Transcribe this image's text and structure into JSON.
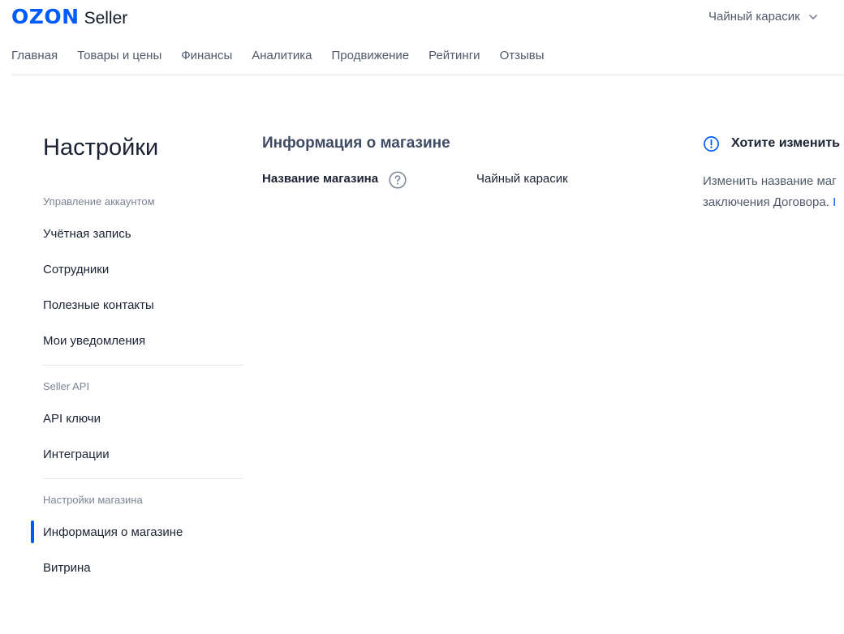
{
  "header": {
    "logo_brand": "OZON",
    "logo_product": "Seller",
    "account_name": "Чайный карасик",
    "account_chevron_icon": "chevron-down-icon",
    "nav": [
      {
        "label": "Главная"
      },
      {
        "label": "Товары и цены"
      },
      {
        "label": "Финансы"
      },
      {
        "label": "Аналитика"
      },
      {
        "label": "Продвижение"
      },
      {
        "label": "Рейтинги"
      },
      {
        "label": "Отзывы"
      }
    ]
  },
  "sidebar": {
    "title": "Настройки",
    "sections": [
      {
        "title": "Управление аккаунтом",
        "items": [
          {
            "label": "Учётная запись"
          },
          {
            "label": "Сотрудники"
          },
          {
            "label": "Полезные контакты"
          },
          {
            "label": "Мои уведомления"
          }
        ]
      },
      {
        "title": "Seller API",
        "items": [
          {
            "label": "API ключи"
          },
          {
            "label": "Интеграции"
          }
        ]
      },
      {
        "title": "Настройки магазина",
        "items": [
          {
            "label": "Информация о магазине",
            "active": true
          },
          {
            "label": "Витрина"
          }
        ]
      }
    ]
  },
  "main": {
    "heading": "Информация о магазине",
    "field_label": "Название магазина",
    "field_help_icon": "question-circle-icon",
    "field_value": "Чайный карасик"
  },
  "info_panel": {
    "icon": "exclamation-circle-icon",
    "title": "Хотите изменить",
    "line1": "Изменить название маг",
    "line2": "заключения Договора.",
    "line2_link_fragment": "I"
  },
  "colors": {
    "brand": "#005bff",
    "text": "#1a2233",
    "muted": "#505a6b",
    "divider": "#e3e6ec"
  }
}
